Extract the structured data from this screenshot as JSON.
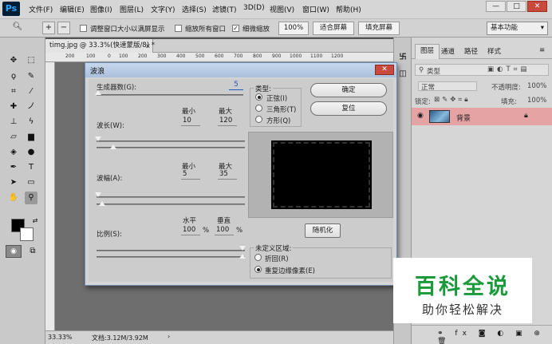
{
  "app": {
    "logo": "Ps"
  },
  "menu": [
    "文件(F)",
    "编辑(E)",
    "图像(I)",
    "图层(L)",
    "文字(Y)",
    "选择(S)",
    "滤镜(T)",
    "3D(D)",
    "视图(V)",
    "窗口(W)",
    "帮助(H)"
  ],
  "window_controls": {
    "minimize": "—",
    "maximize": "□",
    "close": "✕"
  },
  "options_bar": {
    "resize_windows_label": "调整窗口大小以满屏显示",
    "zoom_all_windows_label": "缩放所有窗口",
    "scrubby_zoom_label": "细微缩放",
    "zoom_percent_button": "100%",
    "fit_screen_button": "适合屏幕",
    "fill_screen_button": "填充屏幕",
    "workspace": "基本功能",
    "scrubby_zoom_checked": true
  },
  "document": {
    "tab_title": "timg.jpg @ 33.3%(快速蒙版/8) *",
    "tab_close": "×",
    "ruler_ticks": [
      "200",
      "100",
      "0",
      "100",
      "200",
      "300",
      "400",
      "500",
      "600",
      "700",
      "800",
      "900",
      "1000",
      "1100",
      "1200"
    ],
    "status_zoom": "33.33%",
    "status_doc": "文档:3.12M/3.92M"
  },
  "dialog": {
    "title": "波浪",
    "close": "✕",
    "generators_label": "生成器数(G):",
    "generators_value": "5",
    "wavelength_label": "波长(W):",
    "wavelength_min_label": "最小",
    "wavelength_max_label": "最大",
    "wavelength_min": "10",
    "wavelength_max": "120",
    "amplitude_label": "波幅(A):",
    "amplitude_min_label": "最小",
    "amplitude_max_label": "最大",
    "amplitude_min": "5",
    "amplitude_max": "35",
    "scale_label": "比例(S):",
    "scale_h_label": "水平",
    "scale_v_label": "垂直",
    "scale_h": "100",
    "scale_v": "100",
    "percent": "%",
    "type_label": "类型:",
    "types": [
      "正弦(I)",
      "三角形(T)",
      "方形(Q)"
    ],
    "type_selected": 0,
    "ok_button": "确定",
    "reset_button": "复位",
    "randomize_button": "随机化",
    "undefined_label": "未定义区域:",
    "undefined_options": [
      "折回(R)",
      "重复边缘像素(E)"
    ],
    "undefined_selected": 1
  },
  "layers_panel": {
    "tabs": [
      "图层",
      "通道",
      "路径",
      "样式"
    ],
    "filter_kind": "类型",
    "blend_mode": "正常",
    "opacity_label": "不透明度:",
    "opacity_value": "100%",
    "lock_label": "锁定:",
    "fill_label": "填充:",
    "fill_value": "100%",
    "layer_name": "背景",
    "layer_row_color": "#e5a3a3"
  },
  "watermark": {
    "title": "百科全说",
    "subtitle": "助你轻松解决",
    "color": "#1b9a3c"
  }
}
